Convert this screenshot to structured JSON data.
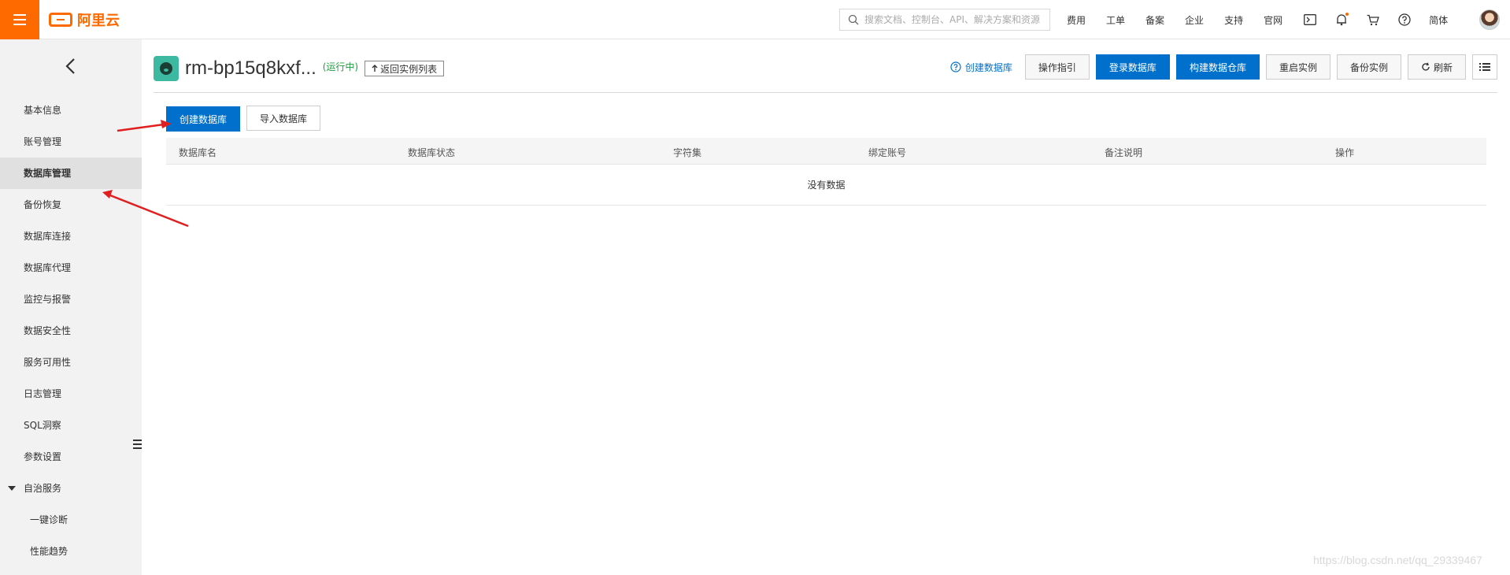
{
  "topbar": {
    "logo_text": "阿里云",
    "search_placeholder": "搜索文档、控制台、API、解决方案和资源",
    "nav": [
      "费用",
      "工单",
      "备案",
      "企业",
      "支持",
      "官网"
    ],
    "icons": [
      "terminal-icon",
      "bell-icon",
      "cart-icon",
      "help-icon"
    ],
    "language": "简体",
    "accent": "#ff6a00"
  },
  "sidebar": {
    "items": [
      {
        "label": "基本信息"
      },
      {
        "label": "账号管理"
      },
      {
        "label": "数据库管理"
      },
      {
        "label": "备份恢复"
      },
      {
        "label": "数据库连接"
      },
      {
        "label": "数据库代理"
      },
      {
        "label": "监控与报警"
      },
      {
        "label": "数据安全性"
      },
      {
        "label": "服务可用性"
      },
      {
        "label": "日志管理"
      },
      {
        "label": "SQL洞察"
      },
      {
        "label": "参数设置"
      },
      {
        "label": "自治服务"
      },
      {
        "label": "一键诊断"
      },
      {
        "label": "性能趋势"
      }
    ],
    "active": "数据库管理"
  },
  "header": {
    "instance_title": "rm-bp15q8kxf...",
    "status": "(运行中)",
    "back_to_list": "返回实例列表",
    "help_link": "创建数据库",
    "buttons": {
      "guide": "操作指引",
      "login_db": "登录数据库",
      "build_warehouse": "构建数据仓库",
      "restart": "重启实例",
      "backup": "备份实例",
      "refresh": "刷新"
    },
    "primary_color": "#0070cc"
  },
  "main": {
    "create_db": "创建数据库",
    "import_db": "导入数据库",
    "table": {
      "columns": [
        "数据库名",
        "数据库状态",
        "字符集",
        "绑定账号",
        "备注说明",
        "操作"
      ],
      "empty_text": "没有数据"
    }
  },
  "watermark": "https://blog.csdn.net/qq_29339467"
}
